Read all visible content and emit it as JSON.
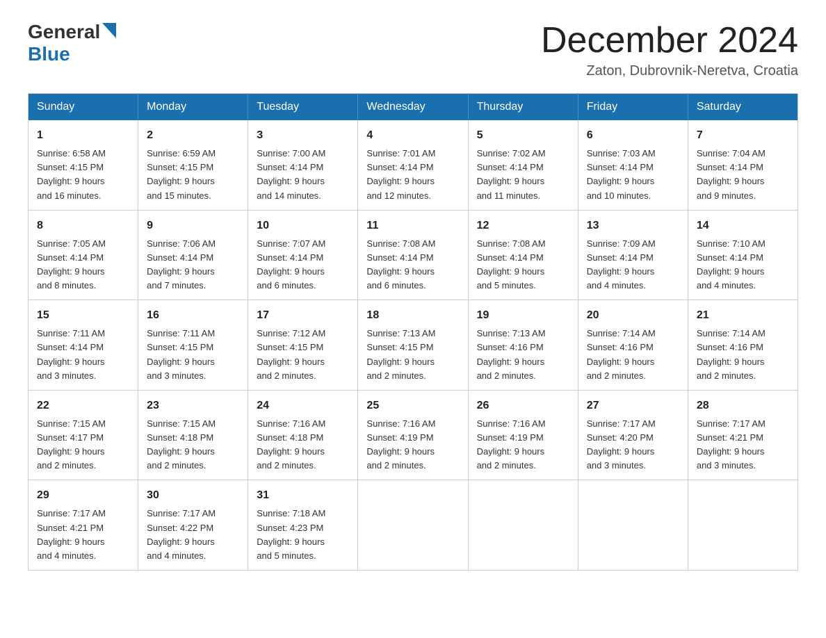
{
  "header": {
    "title": "December 2024",
    "subtitle": "Zaton, Dubrovnik-Neretva, Croatia",
    "logo_general": "General",
    "logo_blue": "Blue"
  },
  "days_of_week": [
    "Sunday",
    "Monday",
    "Tuesday",
    "Wednesday",
    "Thursday",
    "Friday",
    "Saturday"
  ],
  "weeks": [
    [
      {
        "day": "1",
        "sunrise": "6:58 AM",
        "sunset": "4:15 PM",
        "daylight": "9 hours and 16 minutes."
      },
      {
        "day": "2",
        "sunrise": "6:59 AM",
        "sunset": "4:15 PM",
        "daylight": "9 hours and 15 minutes."
      },
      {
        "day": "3",
        "sunrise": "7:00 AM",
        "sunset": "4:14 PM",
        "daylight": "9 hours and 14 minutes."
      },
      {
        "day": "4",
        "sunrise": "7:01 AM",
        "sunset": "4:14 PM",
        "daylight": "9 hours and 12 minutes."
      },
      {
        "day": "5",
        "sunrise": "7:02 AM",
        "sunset": "4:14 PM",
        "daylight": "9 hours and 11 minutes."
      },
      {
        "day": "6",
        "sunrise": "7:03 AM",
        "sunset": "4:14 PM",
        "daylight": "9 hours and 10 minutes."
      },
      {
        "day": "7",
        "sunrise": "7:04 AM",
        "sunset": "4:14 PM",
        "daylight": "9 hours and 9 minutes."
      }
    ],
    [
      {
        "day": "8",
        "sunrise": "7:05 AM",
        "sunset": "4:14 PM",
        "daylight": "9 hours and 8 minutes."
      },
      {
        "day": "9",
        "sunrise": "7:06 AM",
        "sunset": "4:14 PM",
        "daylight": "9 hours and 7 minutes."
      },
      {
        "day": "10",
        "sunrise": "7:07 AM",
        "sunset": "4:14 PM",
        "daylight": "9 hours and 6 minutes."
      },
      {
        "day": "11",
        "sunrise": "7:08 AM",
        "sunset": "4:14 PM",
        "daylight": "9 hours and 6 minutes."
      },
      {
        "day": "12",
        "sunrise": "7:08 AM",
        "sunset": "4:14 PM",
        "daylight": "9 hours and 5 minutes."
      },
      {
        "day": "13",
        "sunrise": "7:09 AM",
        "sunset": "4:14 PM",
        "daylight": "9 hours and 4 minutes."
      },
      {
        "day": "14",
        "sunrise": "7:10 AM",
        "sunset": "4:14 PM",
        "daylight": "9 hours and 4 minutes."
      }
    ],
    [
      {
        "day": "15",
        "sunrise": "7:11 AM",
        "sunset": "4:14 PM",
        "daylight": "9 hours and 3 minutes."
      },
      {
        "day": "16",
        "sunrise": "7:11 AM",
        "sunset": "4:15 PM",
        "daylight": "9 hours and 3 minutes."
      },
      {
        "day": "17",
        "sunrise": "7:12 AM",
        "sunset": "4:15 PM",
        "daylight": "9 hours and 2 minutes."
      },
      {
        "day": "18",
        "sunrise": "7:13 AM",
        "sunset": "4:15 PM",
        "daylight": "9 hours and 2 minutes."
      },
      {
        "day": "19",
        "sunrise": "7:13 AM",
        "sunset": "4:16 PM",
        "daylight": "9 hours and 2 minutes."
      },
      {
        "day": "20",
        "sunrise": "7:14 AM",
        "sunset": "4:16 PM",
        "daylight": "9 hours and 2 minutes."
      },
      {
        "day": "21",
        "sunrise": "7:14 AM",
        "sunset": "4:16 PM",
        "daylight": "9 hours and 2 minutes."
      }
    ],
    [
      {
        "day": "22",
        "sunrise": "7:15 AM",
        "sunset": "4:17 PM",
        "daylight": "9 hours and 2 minutes."
      },
      {
        "day": "23",
        "sunrise": "7:15 AM",
        "sunset": "4:18 PM",
        "daylight": "9 hours and 2 minutes."
      },
      {
        "day": "24",
        "sunrise": "7:16 AM",
        "sunset": "4:18 PM",
        "daylight": "9 hours and 2 minutes."
      },
      {
        "day": "25",
        "sunrise": "7:16 AM",
        "sunset": "4:19 PM",
        "daylight": "9 hours and 2 minutes."
      },
      {
        "day": "26",
        "sunrise": "7:16 AM",
        "sunset": "4:19 PM",
        "daylight": "9 hours and 2 minutes."
      },
      {
        "day": "27",
        "sunrise": "7:17 AM",
        "sunset": "4:20 PM",
        "daylight": "9 hours and 3 minutes."
      },
      {
        "day": "28",
        "sunrise": "7:17 AM",
        "sunset": "4:21 PM",
        "daylight": "9 hours and 3 minutes."
      }
    ],
    [
      {
        "day": "29",
        "sunrise": "7:17 AM",
        "sunset": "4:21 PM",
        "daylight": "9 hours and 4 minutes."
      },
      {
        "day": "30",
        "sunrise": "7:17 AM",
        "sunset": "4:22 PM",
        "daylight": "9 hours and 4 minutes."
      },
      {
        "day": "31",
        "sunrise": "7:18 AM",
        "sunset": "4:23 PM",
        "daylight": "9 hours and 5 minutes."
      },
      null,
      null,
      null,
      null
    ]
  ],
  "labels": {
    "sunrise": "Sunrise:",
    "sunset": "Sunset:",
    "daylight": "Daylight:"
  }
}
